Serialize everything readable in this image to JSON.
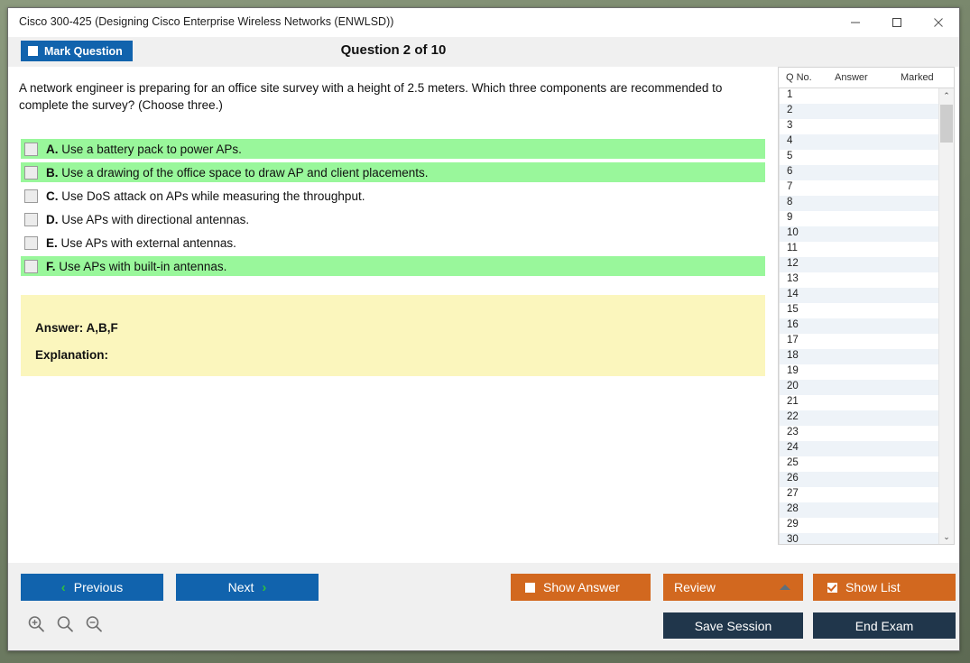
{
  "window": {
    "title": "Cisco 300-425 (Designing Cisco Enterprise Wireless Networks (ENWLSD))",
    "minimize_label": "Minimize",
    "maximize_label": "Maximize",
    "close_label": "Close"
  },
  "toolbar": {
    "mark_question_label": "Mark Question",
    "mark_question_checked": false,
    "question_counter": "Question 2 of 10"
  },
  "question": {
    "text": "A network engineer is preparing for an office site survey with a height of 2.5 meters. Which three components are recommended to complete the survey? (Choose three.)",
    "options": [
      {
        "letter": "A.",
        "text": "Use a battery pack to power APs.",
        "correct": true,
        "checked": false
      },
      {
        "letter": "B.",
        "text": "Use a drawing of the office space to draw AP and client placements.",
        "correct": true,
        "checked": false
      },
      {
        "letter": "C.",
        "text": "Use DoS attack on APs while measuring the throughput.",
        "correct": false,
        "checked": false
      },
      {
        "letter": "D.",
        "text": "Use APs with directional antennas.",
        "correct": false,
        "checked": false
      },
      {
        "letter": "E.",
        "text": "Use APs with external antennas.",
        "correct": false,
        "checked": false
      },
      {
        "letter": "F.",
        "text": "Use APs with built-in antennas.",
        "correct": true,
        "checked": false
      }
    ]
  },
  "answer_box": {
    "answer_label": "Answer: A,B,F",
    "explanation_label": "Explanation:"
  },
  "question_list": {
    "columns": {
      "qno": "Q No.",
      "answer": "Answer",
      "marked": "Marked"
    },
    "rows": [
      {
        "qno": "1",
        "answer": "",
        "marked": ""
      },
      {
        "qno": "2",
        "answer": "",
        "marked": ""
      },
      {
        "qno": "3",
        "answer": "",
        "marked": ""
      },
      {
        "qno": "4",
        "answer": "",
        "marked": ""
      },
      {
        "qno": "5",
        "answer": "",
        "marked": ""
      },
      {
        "qno": "6",
        "answer": "",
        "marked": ""
      },
      {
        "qno": "7",
        "answer": "",
        "marked": ""
      },
      {
        "qno": "8",
        "answer": "",
        "marked": ""
      },
      {
        "qno": "9",
        "answer": "",
        "marked": ""
      },
      {
        "qno": "10",
        "answer": "",
        "marked": ""
      },
      {
        "qno": "11",
        "answer": "",
        "marked": ""
      },
      {
        "qno": "12",
        "answer": "",
        "marked": ""
      },
      {
        "qno": "13",
        "answer": "",
        "marked": ""
      },
      {
        "qno": "14",
        "answer": "",
        "marked": ""
      },
      {
        "qno": "15",
        "answer": "",
        "marked": ""
      },
      {
        "qno": "16",
        "answer": "",
        "marked": ""
      },
      {
        "qno": "17",
        "answer": "",
        "marked": ""
      },
      {
        "qno": "18",
        "answer": "",
        "marked": ""
      },
      {
        "qno": "19",
        "answer": "",
        "marked": ""
      },
      {
        "qno": "20",
        "answer": "",
        "marked": ""
      },
      {
        "qno": "21",
        "answer": "",
        "marked": ""
      },
      {
        "qno": "22",
        "answer": "",
        "marked": ""
      },
      {
        "qno": "23",
        "answer": "",
        "marked": ""
      },
      {
        "qno": "24",
        "answer": "",
        "marked": ""
      },
      {
        "qno": "25",
        "answer": "",
        "marked": ""
      },
      {
        "qno": "26",
        "answer": "",
        "marked": ""
      },
      {
        "qno": "27",
        "answer": "",
        "marked": ""
      },
      {
        "qno": "28",
        "answer": "",
        "marked": ""
      },
      {
        "qno": "29",
        "answer": "",
        "marked": ""
      },
      {
        "qno": "30",
        "answer": "",
        "marked": ""
      }
    ],
    "scroll_up_glyph": "⌃",
    "scroll_down_glyph": "⌄"
  },
  "bottom_bar": {
    "previous_label": "Previous",
    "previous_chevron": "‹",
    "next_label": "Next",
    "next_chevron": "›",
    "show_answer_label": "Show Answer",
    "show_answer_checked": false,
    "review_label": "Review",
    "show_list_label": "Show List",
    "show_list_checked": true,
    "save_session_label": "Save Session",
    "end_exam_label": "End Exam",
    "zoom_in_label": "Zoom In",
    "zoom_reset_label": "Zoom Reset",
    "zoom_out_label": "Zoom Out"
  },
  "colors": {
    "primary_blue": "#1163ad",
    "orange": "#d2681f",
    "navy": "#20364b",
    "correct_green": "#99f79b",
    "answer_yellow": "#fbf6bd",
    "chevron_green": "#2fbf3f"
  }
}
